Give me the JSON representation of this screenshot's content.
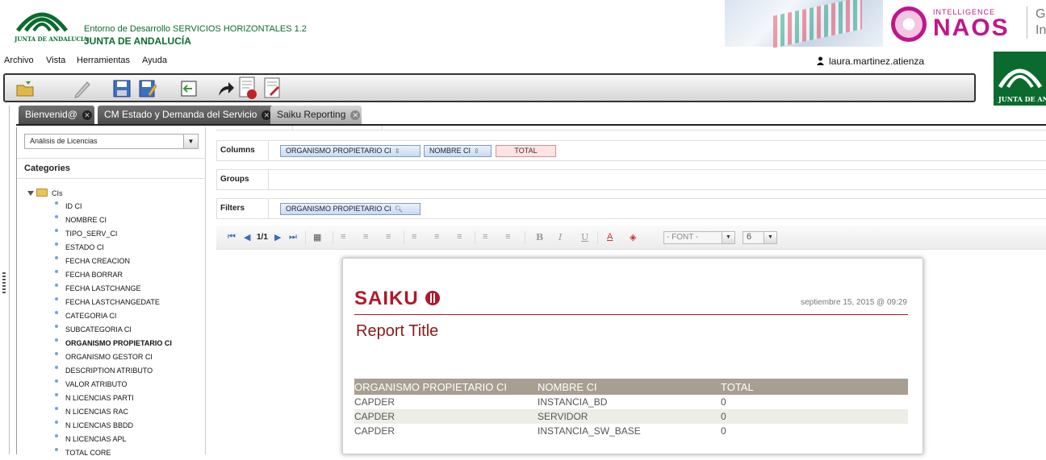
{
  "header": {
    "app_title": "Entorno de Desarrollo SERVICIOS HORIZONTALES 1.2",
    "org_name": "JUNTA DE ANDALUCÍA",
    "logo_text": "JUNTA DE ANDALUCIA",
    "banner": {
      "sub": "INTELLIGENCE",
      "brand": "NAOS",
      "side_text_1": "Ge",
      "side_text_2": "In"
    }
  },
  "menu": {
    "items": [
      "Archivo",
      "Vista",
      "Herramientas",
      "Ayuda"
    ],
    "user": "laura.martinez.atienza"
  },
  "tabs": [
    {
      "label": "Bienvenid@"
    },
    {
      "label": "CM Estado y Demanda del Servicio"
    },
    {
      "label": "Saiku Reporting"
    }
  ],
  "sidebar": {
    "cube": "Análisis de Licencias",
    "categories_title": "Categories",
    "root": "CIs",
    "dimensions": [
      "ID CI",
      "NOMBRE CI",
      "TIPO_SERV_CI",
      "ESTADO CI",
      "FECHA CREACION",
      "FECHA BORRAR",
      "FECHA LASTCHANGE",
      "FECHA LASTCHANGEDATE",
      "CATEGORIA CI",
      "SUBCATEGORIA CI",
      "ORGANISMO PROPIETARIO CI",
      "ORGANISMO GESTOR CI",
      "DESCRIPTION ATRIBUTO",
      "VALOR ATRIBUTO",
      "N LICENCIAS PARTI",
      "N LICENCIAS RAC",
      "N LICENCIAS BBDD",
      "N LICENCIAS APL",
      "TOTAL CORE"
    ]
  },
  "query": {
    "columns_label": "Columns",
    "groups_label": "Groups",
    "filters_label": "Filters",
    "columns": [
      "ORGANISMO PROPIETARIO CI",
      "NOMBRE CI",
      "TOTAL"
    ],
    "filters": [
      "ORGANISMO PROPIETARIO CI"
    ]
  },
  "report_toolbar": {
    "page": "1/1",
    "font": "- FONT -",
    "size": "6"
  },
  "report": {
    "brand": "SAIKU",
    "date": "septiembre 15, 2015 @ 09:29",
    "title": "Report Title",
    "headers": [
      "ORGANISMO PROPIETARIO CI",
      "NOMBRE CI",
      "TOTAL"
    ],
    "rows": [
      [
        "CAPDER",
        "INSTANCIA_BD",
        "0"
      ],
      [
        "CAPDER",
        "SERVIDOR",
        "0"
      ],
      [
        "CAPDER",
        "INSTANCIA_SW_BASE",
        "0"
      ]
    ]
  },
  "colors": {
    "junta_green": "#0b6b2e",
    "saiku_red": "#b0182a",
    "naos_magenta": "#c0178a",
    "table_header": "#a69f92"
  }
}
